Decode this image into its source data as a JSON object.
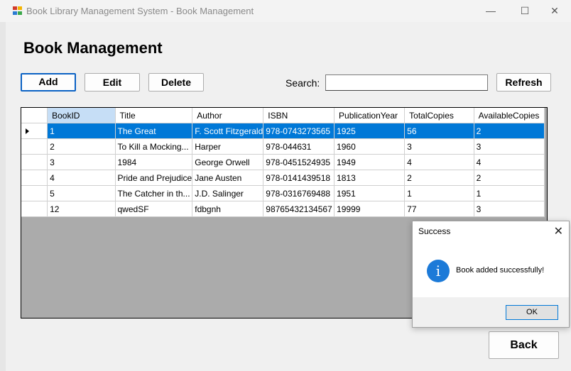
{
  "window": {
    "title": "Book Library Management System - Book Management",
    "minimize_label": "—",
    "maximize_label": "☐",
    "close_label": "✕"
  },
  "heading": "Book Management",
  "toolbar": {
    "add_label": "Add",
    "edit_label": "Edit",
    "delete_label": "Delete",
    "search_label": "Search:",
    "search_value": "",
    "refresh_label": "Refresh"
  },
  "table": {
    "columns": [
      "BookID",
      "Title",
      "Author",
      "ISBN",
      "PublicationYear",
      "TotalCopies",
      "AvailableCopies"
    ],
    "rows": [
      [
        "1",
        "The Great",
        "F. Scott Fitzgerald",
        "978-0743273565",
        "1925",
        "56",
        "2"
      ],
      [
        "2",
        "To Kill a Mocking...",
        "Harper",
        "978-044631",
        "1960",
        "3",
        "3"
      ],
      [
        "3",
        "1984",
        "George Orwell",
        "978-0451524935",
        "1949",
        "4",
        "4"
      ],
      [
        "4",
        "Pride and Prejudice",
        "Jane Austen",
        "978-0141439518",
        "1813",
        "2",
        "2"
      ],
      [
        "5",
        "The Catcher in th...",
        "J.D. Salinger",
        "978-0316769488",
        "1951",
        "1",
        "1"
      ],
      [
        "12",
        "qwedSF",
        "fdbgnh",
        "98765432134567",
        "19999",
        "77",
        "3"
      ]
    ],
    "selected_row": 0
  },
  "dialog": {
    "title": "Success",
    "message": "Book added successfully!",
    "ok_label": "OK",
    "icon": "info-icon",
    "close_label": "✕"
  },
  "back_label": "Back",
  "colors": {
    "selection": "#0078d7",
    "selected_header": "#c6def6",
    "grid_background": "#ababab",
    "info_icon": "#1c7ad8"
  }
}
